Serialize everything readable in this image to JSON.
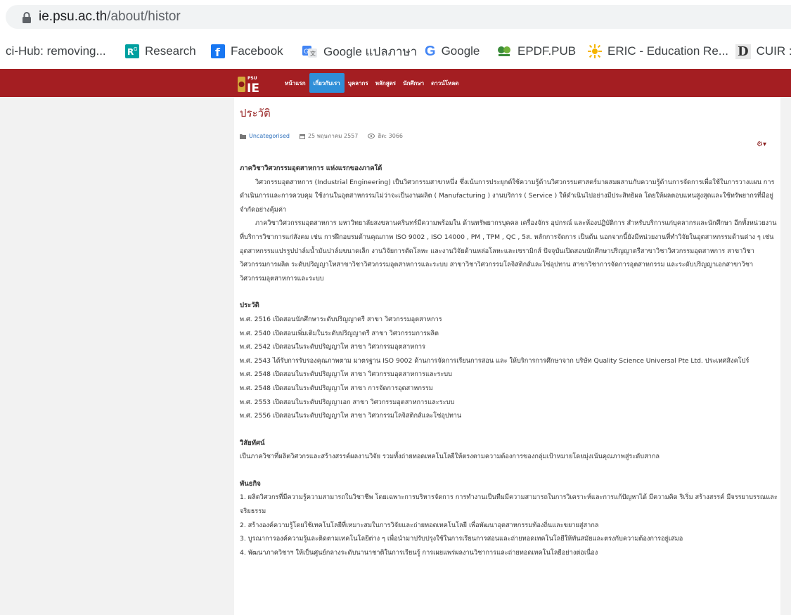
{
  "browser": {
    "url_host": "ie.psu.ac.th",
    "url_path": "/about/histor",
    "bookmarks": [
      {
        "label": "ci-Hub: removing...",
        "icon": "none"
      },
      {
        "label": "Research",
        "icon": "researchgate-icon"
      },
      {
        "label": "Facebook",
        "icon": "facebook-icon"
      },
      {
        "label": "Google แปลภาษา",
        "icon": "google-translate-icon"
      },
      {
        "label": "Google",
        "icon": "google-icon"
      },
      {
        "label": "EPDF.PUB",
        "icon": "epdf-icon"
      },
      {
        "label": "ERIC - Education Re...",
        "icon": "eric-icon"
      },
      {
        "label": "CUIR :",
        "icon": "cuir-icon"
      }
    ]
  },
  "site": {
    "logo_text": "PSU IE",
    "nav": [
      "หน้าแรก",
      "เกี่ยวกับเรา",
      "บุคลากร",
      "หลักสูตร",
      "นักศึกษา",
      "ดาวน์โหลด"
    ],
    "nav_active": "เกี่ยวกับเรา",
    "colors": {
      "nav_bg": "#a41e22",
      "active": "#2f8fd8",
      "title": "#9c2d2d"
    }
  },
  "article": {
    "title": "ประวัติ",
    "category": "Uncategorised",
    "date": "25 พฤษภาคม 2557",
    "hits": "ฮิต: 3066",
    "heading1": "ภาควิชาวิศวกรรมอุตสาหการ แห่งแรกของภาคใต้",
    "para1": "วิศวกรรมอุตสาหการ (Industrial Engineering) เป็นวิศวกรรมสาขาหนึ่ง ซึ่งเน้นการประยุกต์ใช้ความรู้ด้านวิศวกรรมศาสตร์มาผสมผสานกับความรู้ด้านการจัดการเพื่อใช้ในการวางแผน การดำเนินการและการควบคุม ใช้งานในอุตสาหกรรมไม่ว่าจะเป็นงานผลิต ( Manufacturing ) งานบริการ ( Service ) ให้ดำเนินไปอย่างมีประสิทธิผล โดยให้ผลตอบแทนสูงสุดและใช้ทรัพยากรที่มีอยู่จำกัดอย่างคุ้มค่า",
    "para2": "ภาควิชาวิศวกรรมอุตสาหการ มหาวิทยาลัยสงขลานครินทร์มีความพร้อมใน ด้านทรัพยากรบุคคล เครื่องจักร อุปกรณ์ และห้องปฏิบัติการ สำหรับบริการแก่บุคลากรและนักศึกษา อีกทั้งหน่วยงานที่บริการวิชาการแก่สังคม เช่น การฝึกอบรมด้านคุณภาพ ISO 9002 , ISO 14000 , PM , TPM , QC , 5ส. หลักการจัดการ เป็นต้น นอกจากนี้ยังมีหน่วยงานที่ทำวิจัยในอุตสาหกรรมด้านต่าง ๆ เช่น อุตสาหกรรมแปรรูปปาล์มน้ำมันปาล์มขนาดเล็ก งานวิจัยการตัดโลหะ และงานวิจัยด้านหล่อโลหะและเซรามิกส์ ปัจจุบันเปิดสอนนักศึกษาปริญญาตรีสาขาวิชาวิศวกรรมอุตสาหการ สาขาวิชาวิศวกรรมการผลิต ระดับปริญญาโทสาขาวิชาวิศวกรรมอุตสาหการและระบบ สาขาวิชาวิศวกรรมโลจิสติกส์และโซ่อุปทาน สาขาวิชาการจัดการอุตสาหกรรม และระดับปริญญาเอกสาขาวิชาวิศวกรรมอุตสาหการและระบบ",
    "history_heading": "ประวัติ",
    "history": [
      "พ.ศ. 2516 เปิดสอนนักศึกษาระดับปริญญาตรี สาขา วิศวกรรมอุตสาหการ",
      "พ.ศ. 2540 เปิดสอนเพิ่มเติมในระดับปริญญาตรี สาขา วิศวกรรมการผลิต",
      "พ.ศ. 2542 เปิดสอนในระดับปริญญาโท สาขา วิศวกรรมอุตสาหการ",
      "พ.ศ. 2543 ได้รับการรับรองคุณภาพตาม มาตรฐาน ISO 9002 ด้านการจัดการเรียนการสอน และ ให้บริการการศึกษาจาก บริษัท Quality Science Universal Pte Ltd. ประเทศสิงคโปร์",
      "พ.ศ. 2548 เปิดสอนในระดับปริญญาโท สาขา วิศวกรรมอุตสาหการและระบบ",
      "พ.ศ. 2548 เปิดสอนในระดับปริญญาโท สาขา การจัดการอุตสาหกรรม",
      "พ.ศ. 2553 เปิดสอนในระดับปริญญาเอก สาขา วิศวกรรมอุตสาหการและระบบ",
      "พ.ศ. 2556 เปิดสอนในระดับปริญญาโท สาขา วิศวกรรมโลจิสติกส์และโซ่อุปทาน"
    ],
    "vision_heading": "วิสัยทัศน์",
    "vision": "เป็นภาควิชาที่ผลิตวิศวกรและสร้างสรรค์ผลงานวิจัย รวมทั้งถ่ายทอดเทคโนโลยีให้ตรงตามความต้องการของกลุ่มเป้าหมายโดยมุ่งเน้นคุณภาพสู่ระดับสากล",
    "mission_heading": "พันธกิจ",
    "mission": [
      "1. ผลิตวิศวกรที่มีความรู้ความสามารถในวิชาชีพ โดยเฉพาะการบริหารจัดการ การทำงานเป็นทีมมีความสามารถในการวิเคราะห์และการแก้ปัญหาได้ มีความคิด ริเริ่ม สร้างสรรค์ มีจรรยาบรรณและจริยธรรม",
      "2. สร้างองค์ความรู้โดยใช้เทคโนโลยีที่เหมาะสมในการวิจัยและถ่ายทอดเทคโนโลยี เพื่อพัฒนาอุตสาหกรรมท้องถิ่นและขยายสู่สากล",
      "3. บูรณาการองค์ความรู้และติดตามเทคโนโลยีต่าง ๆ เพื่อนำมาปรับปรุงใช้ในการเรียนการสอนและถ่ายทอดเทคโนโลยีให้ทันสมัยและตรงกับความต้องการอยู่เสมอ",
      "4. พัฒนาภาควิชาฯ ให้เป็นศูนย์กลางระดับนานาชาติในการเรียนรู้ การเผยแพร่ผลงานวิชาการและถ่ายทอดเทคโนโลยีอย่างต่อเนื่อง"
    ]
  }
}
